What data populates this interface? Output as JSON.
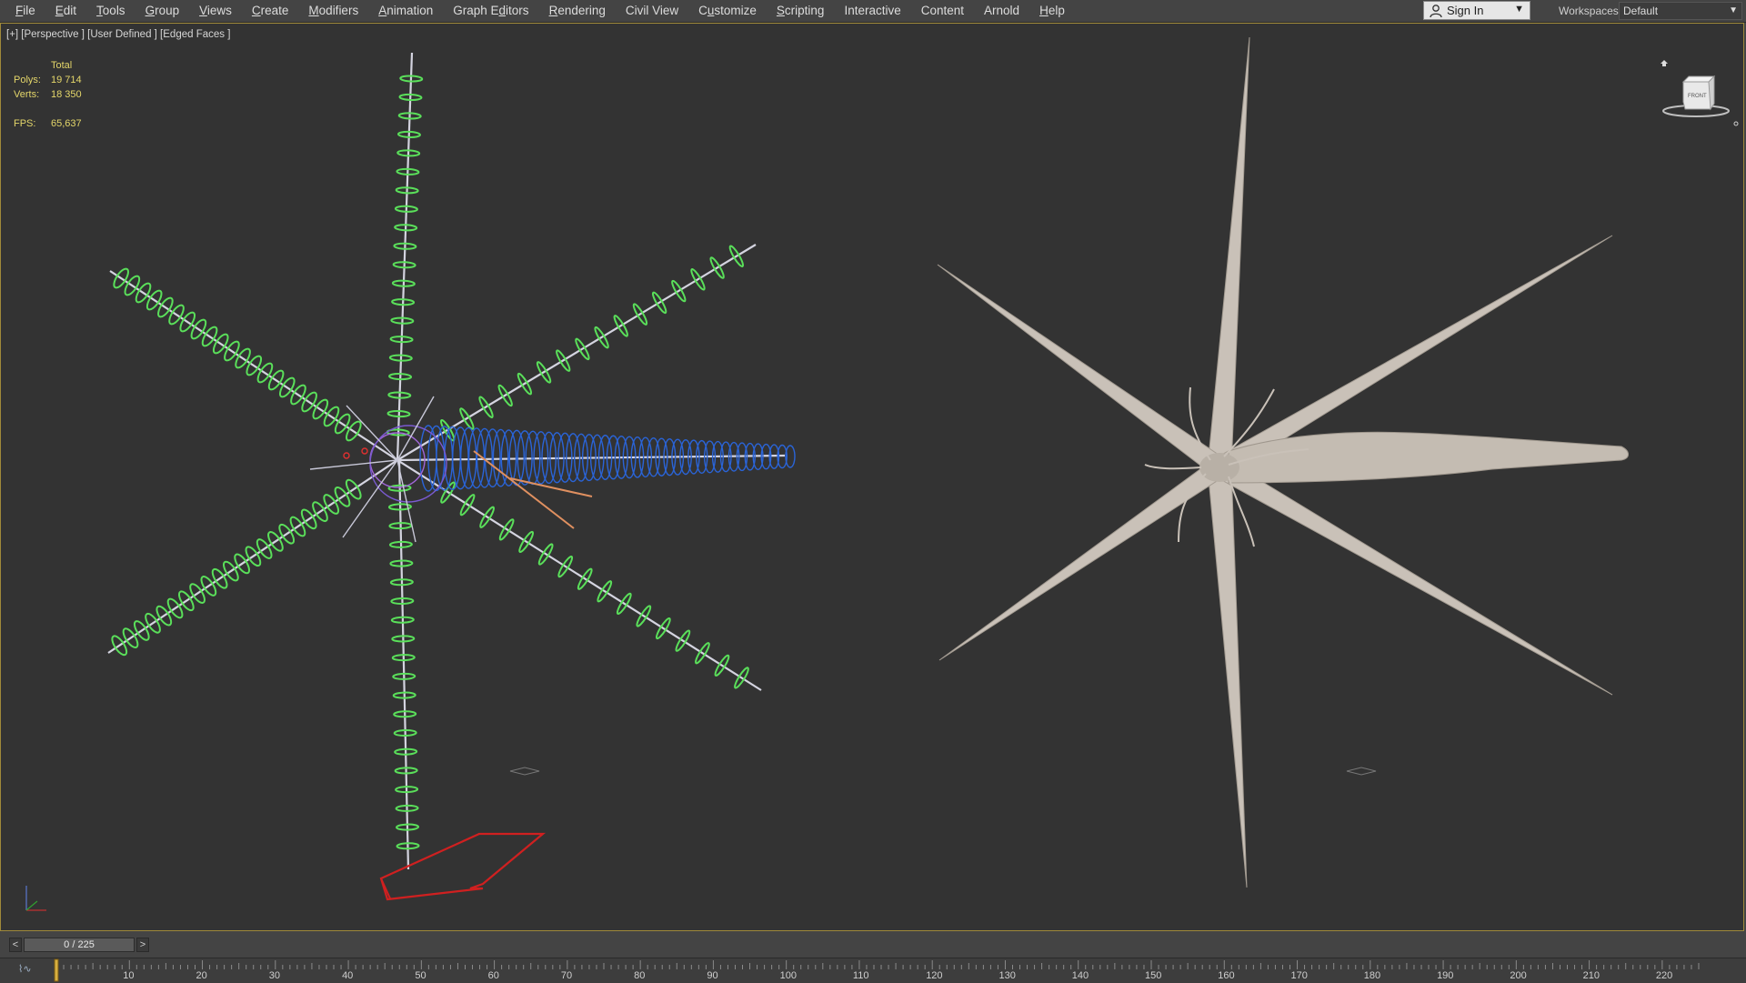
{
  "menu": {
    "items": [
      {
        "pre": "",
        "ul": "F",
        "post": "ile",
        "name": "menu-file"
      },
      {
        "pre": "",
        "ul": "E",
        "post": "dit",
        "name": "menu-edit"
      },
      {
        "pre": "",
        "ul": "T",
        "post": "ools",
        "name": "menu-tools"
      },
      {
        "pre": "",
        "ul": "G",
        "post": "roup",
        "name": "menu-group"
      },
      {
        "pre": "",
        "ul": "V",
        "post": "iews",
        "name": "menu-views"
      },
      {
        "pre": "",
        "ul": "C",
        "post": "reate",
        "name": "menu-create"
      },
      {
        "pre": "",
        "ul": "M",
        "post": "odifiers",
        "name": "menu-modifiers"
      },
      {
        "pre": "",
        "ul": "A",
        "post": "nimation",
        "name": "menu-animation"
      },
      {
        "pre": "Graph E",
        "ul": "d",
        "post": "itors",
        "name": "menu-graph-editors"
      },
      {
        "pre": "",
        "ul": "R",
        "post": "endering",
        "name": "menu-rendering"
      },
      {
        "pre": "Civil View",
        "ul": "",
        "post": "",
        "name": "menu-civil-view"
      },
      {
        "pre": "C",
        "ul": "u",
        "post": "stomize",
        "name": "menu-customize"
      },
      {
        "pre": "",
        "ul": "S",
        "post": "cripting",
        "name": "menu-scripting"
      },
      {
        "pre": "Interactive",
        "ul": "",
        "post": "",
        "name": "menu-interactive"
      },
      {
        "pre": "Content",
        "ul": "",
        "post": "",
        "name": "menu-content"
      },
      {
        "pre": "Arnold",
        "ul": "",
        "post": "",
        "name": "menu-arnold"
      },
      {
        "pre": "",
        "ul": "H",
        "post": "elp",
        "name": "menu-help"
      }
    ]
  },
  "header": {
    "signin_label": "Sign In",
    "workspaces_label": "Workspaces:",
    "workspace_value": "Default"
  },
  "viewport": {
    "label": "[+] [Perspective ] [User Defined ] [Edged Faces ]",
    "stats": {
      "total_label": "Total",
      "polys_label": "Polys:",
      "polys_value": "19 714",
      "verts_label": "Verts:",
      "verts_value": "18 350",
      "fps_label": "FPS:",
      "fps_value": "65,637"
    },
    "viewcube_label": "FRONT"
  },
  "timeline": {
    "prev_label": "<",
    "slider_value": "0 / 225",
    "next_label": ">",
    "ticks": [
      "10",
      "20",
      "30",
      "40",
      "50",
      "60",
      "70",
      "80",
      "90",
      "100",
      "110",
      "120",
      "130",
      "140",
      "150",
      "160",
      "170",
      "180",
      "190",
      "200",
      "210",
      "220"
    ],
    "current_frame": 0,
    "total_frames": 225
  },
  "colors": {
    "accent_border": "#a08a3a",
    "stats_text": "#e4d66a",
    "rig_green": "#5adf5a",
    "spline_blue": "#2a64d8",
    "mesh_color": "#c9c1b8",
    "arrow_red": "#d02020"
  }
}
